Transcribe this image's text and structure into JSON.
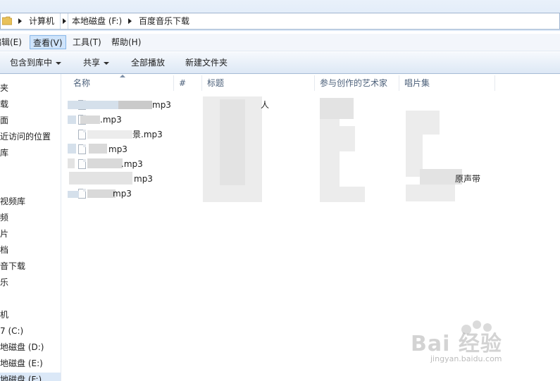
{
  "address": {
    "crumbs": [
      "计算机",
      "本地磁盘 (F:)",
      "百度音乐下载"
    ]
  },
  "menu": {
    "items": [
      "编辑(E)",
      "查看(V)",
      "工具(T)",
      "帮助(H)"
    ]
  },
  "toolbar": {
    "include_library": "包含到库中",
    "share": "共享",
    "play_all": "全部播放",
    "new_folder": "新建文件夹"
  },
  "nav": {
    "items": [
      "夹",
      "载",
      "面",
      "近访问的位置",
      "库",
      "视频库",
      "频",
      "片",
      "档",
      "音下载",
      "乐",
      "机",
      "7 (C:)",
      "地磁盘 (D:)",
      "地磁盘 (E:)",
      "地磁盘 (F:)"
    ]
  },
  "columns": {
    "name": "名称",
    "number": "#",
    "title": "标题",
    "artist": "参与创作的艺术家",
    "album": "唱片集"
  },
  "files": [
    {
      "name_visible": "mp3"
    },
    {
      "name_visible": ".mp3"
    },
    {
      "name_visible": "景.mp3"
    },
    {
      "name_visible": "mp3"
    },
    {
      "name_visible": ".mp3"
    },
    {
      "name_visible": "mp3"
    },
    {
      "name_visible": "mp3"
    }
  ],
  "cells": {
    "title_row1": "人",
    "album_row6": "原声带"
  },
  "watermark": {
    "logo": "Bai 经验",
    "url": "jingyan.baidu.com"
  },
  "colors": {
    "menu_active": "#cfe4fb",
    "toolbar_bg": "#dde8f5",
    "column_header_text": "#4c607a"
  }
}
